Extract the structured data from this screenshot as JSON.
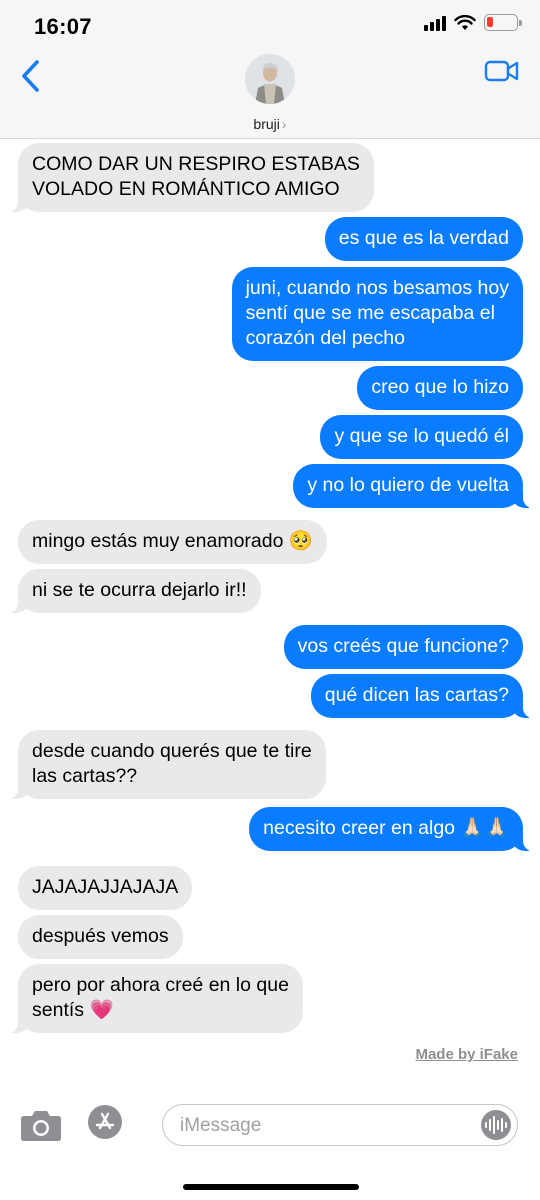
{
  "status_bar": {
    "time": "16:07"
  },
  "header": {
    "contact_name": "bruji",
    "chevron": "›"
  },
  "messages": [
    {
      "dir": "in",
      "text": "COMO DAR UN RESPIRO ESTABAS\nVOLADO EN ROMÁNTICO AMIGO"
    },
    {
      "dir": "out",
      "text": "es que es la verdad"
    },
    {
      "dir": "out",
      "text": "juni, cuando nos besamos hoy\nsentí que se me escapaba el\ncorazón del pecho"
    },
    {
      "dir": "out",
      "text": "creo que lo hizo"
    },
    {
      "dir": "out",
      "text": "y que se lo quedó él"
    },
    {
      "dir": "out",
      "text": "y no lo quiero de vuelta"
    },
    {
      "dir": "in",
      "text": "mingo estás muy enamorado 🥺"
    },
    {
      "dir": "in",
      "text": "ni se te ocurra dejarlo ir!!"
    },
    {
      "dir": "out",
      "text": "vos creés que funcione?"
    },
    {
      "dir": "out",
      "text": "qué dicen las cartas?"
    },
    {
      "dir": "in",
      "text": "desde cuando querés que te tire\nlas cartas??"
    },
    {
      "dir": "out",
      "text": "necesito creer en algo 🙏🏻🙏🏻"
    },
    {
      "dir": "in",
      "text": "JAJAJAJJAJAJA"
    },
    {
      "dir": "in",
      "text": "después vemos"
    },
    {
      "dir": "in",
      "text": "pero por ahora creé en lo que\nsentís 💗"
    }
  ],
  "watermark": "Made by iFake",
  "input": {
    "placeholder": "iMessage"
  },
  "colors": {
    "outgoing": "#0a7cff",
    "incoming": "#e9e9eb",
    "accent": "#1a7ef0"
  },
  "icons": [
    "back-chevron-icon",
    "video-camera-icon",
    "camera-icon",
    "app-store-icon",
    "audio-waveform-icon",
    "signal-icon",
    "wifi-icon",
    "battery-icon"
  ]
}
